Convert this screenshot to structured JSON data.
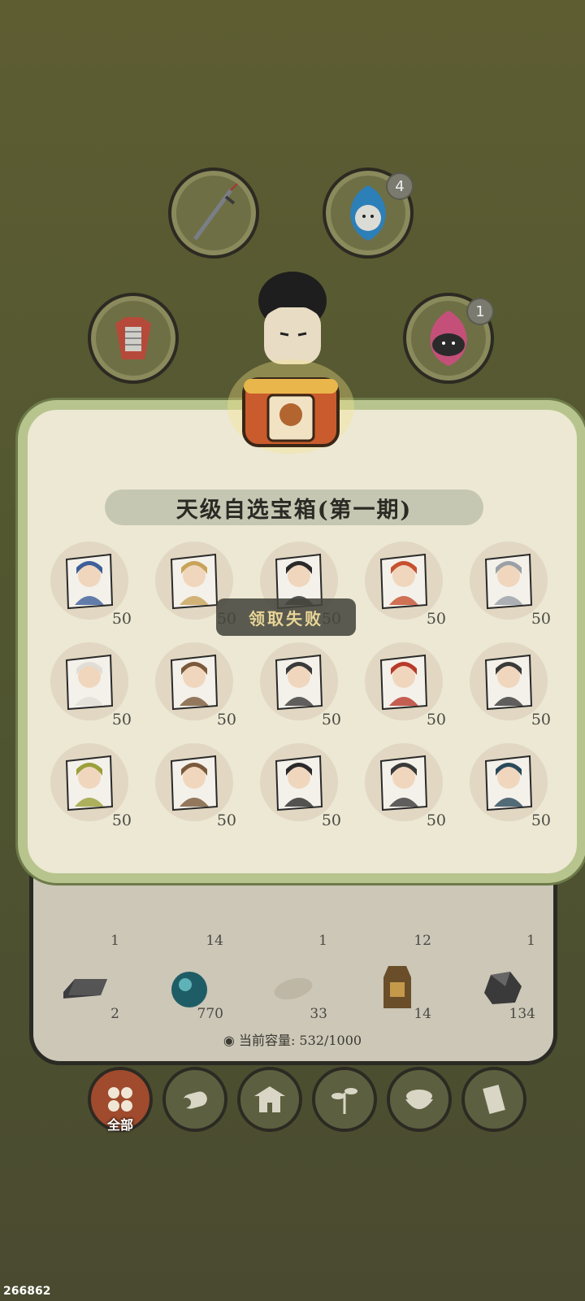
{
  "equipment": {
    "slots": [
      {
        "name": "weapon-slot",
        "icon": "sword-icon",
        "badge": ""
      },
      {
        "name": "spirit-blue-slot",
        "icon": "blue-spirit-icon",
        "badge": "4"
      },
      {
        "name": "armor-slot",
        "icon": "armor-icon",
        "badge": ""
      },
      {
        "name": "spirit-red-slot",
        "icon": "red-spirit-icon",
        "badge": "1"
      }
    ]
  },
  "modal": {
    "title": "天级自选宝箱(第一期)",
    "items": [
      {
        "count": "50"
      },
      {
        "count": "50"
      },
      {
        "count": "50"
      },
      {
        "count": "50"
      },
      {
        "count": "50"
      },
      {
        "count": "50"
      },
      {
        "count": "50"
      },
      {
        "count": "50"
      },
      {
        "count": "50"
      },
      {
        "count": "50"
      },
      {
        "count": "50"
      },
      {
        "count": "50"
      },
      {
        "count": "50"
      },
      {
        "count": "50"
      },
      {
        "count": "50"
      }
    ],
    "toast": "领取失败"
  },
  "inventory": {
    "row1_counts": [
      "1",
      "14",
      "1",
      "12",
      "1"
    ],
    "row2": [
      {
        "icon": "iron-ingot-icon",
        "count": "2"
      },
      {
        "icon": "spirit-orb-icon",
        "count": "770"
      },
      {
        "icon": "stone-icon",
        "count": "33"
      },
      {
        "icon": "token-icon",
        "count": "14"
      },
      {
        "icon": "ore-icon",
        "count": "134"
      }
    ],
    "capacity_label": "当前容量: 532/1000"
  },
  "tabs": {
    "all_label": "全部",
    "items": [
      "all-tab",
      "wood-tab",
      "building-tab",
      "herb-tab",
      "food-tab",
      "scroll-tab"
    ]
  },
  "footer_id": "266862",
  "colors": {
    "accent": "#a04b2d",
    "panel": "#ece8d3",
    "frame": "#b7c48e"
  }
}
